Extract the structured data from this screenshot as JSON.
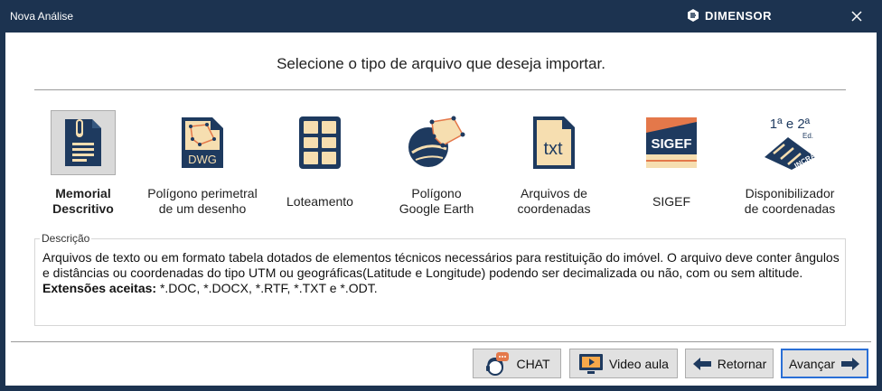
{
  "window": {
    "title": "Nova Análise",
    "brand": "DIMENSOR"
  },
  "heading": "Selecione o tipo de arquivo que deseja importar.",
  "options": [
    {
      "label": "Memorial\nDescritivo",
      "icon": "memorial-descritivo-icon",
      "selected": true
    },
    {
      "label": "Polígono perimetral\nde um desenho",
      "icon": "dwg-file-icon"
    },
    {
      "label": "Loteamento",
      "icon": "loteamento-grid-icon"
    },
    {
      "label": "Polígono\nGoogle Earth",
      "icon": "google-earth-icon"
    },
    {
      "label": "Arquivos de\ncoordenadas",
      "icon": "txt-file-icon"
    },
    {
      "label": "SIGEF",
      "icon": "sigef-icon"
    },
    {
      "label": "Disponibilizador\nde coordenadas",
      "icon": "incra-icon"
    }
  ],
  "description": {
    "legend": "Descrição",
    "text": "Arquivos de texto ou em formato tabela dotados de elementos técnicos necessários para restituição do imóvel. O arquivo deve conter ângulos e distâncias ou coordenadas do tipo UTM ou geográficas(Latitude e Longitude) podendo ser decimalizada ou não, com ou sem altitude.",
    "ext_label": "Extensões aceitas:",
    "ext_value": " *.DOC, *.DOCX, *.RTF, *.TXT e *.ODT."
  },
  "buttons": {
    "chat": "CHAT",
    "video": "Video aula",
    "back": "Retornar",
    "next": "Avançar"
  },
  "icons": {
    "sigef_text": "SIGEF",
    "dwg_text": "DWG",
    "txt_text": "txt",
    "incra_top": "1ª e 2ª",
    "incra_ed": "Ed.",
    "incra_text": "INCRA"
  },
  "colors": {
    "titlebar": "#1c3350",
    "navy": "#1e3a5f",
    "cream": "#f6deb0",
    "accent": "#e4784a",
    "primary_border": "#2a6fd6"
  }
}
